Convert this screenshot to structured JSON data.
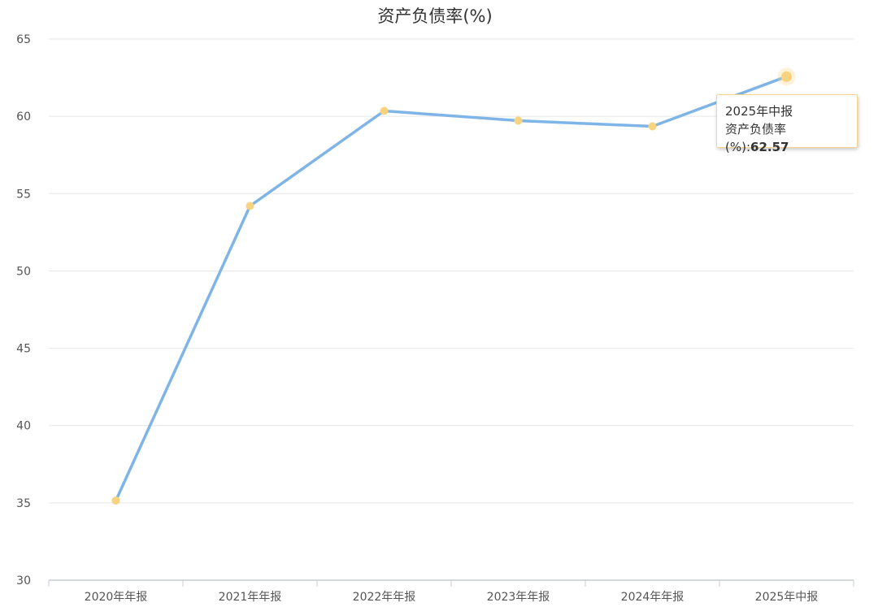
{
  "chart_data": {
    "type": "line",
    "title": "资产负债率(%)",
    "categories": [
      "2020年年报",
      "2021年年报",
      "2022年年报",
      "2023年年报",
      "2024年年报",
      "2025年中报"
    ],
    "values": [
      35.15,
      54.2,
      60.35,
      59.72,
      59.35,
      62.57
    ],
    "ylim": [
      30,
      65
    ],
    "yticks": [
      30,
      35,
      40,
      45,
      50,
      55,
      60,
      65
    ],
    "grid": true,
    "colors": {
      "line": "#7fb5e6",
      "point": "#f8d37f",
      "grid": "#e6e6e6"
    }
  },
  "tooltip": {
    "category": "2025年中报",
    "series_label": "资产负债率(%)",
    "separator": ":",
    "value": "62.57"
  }
}
